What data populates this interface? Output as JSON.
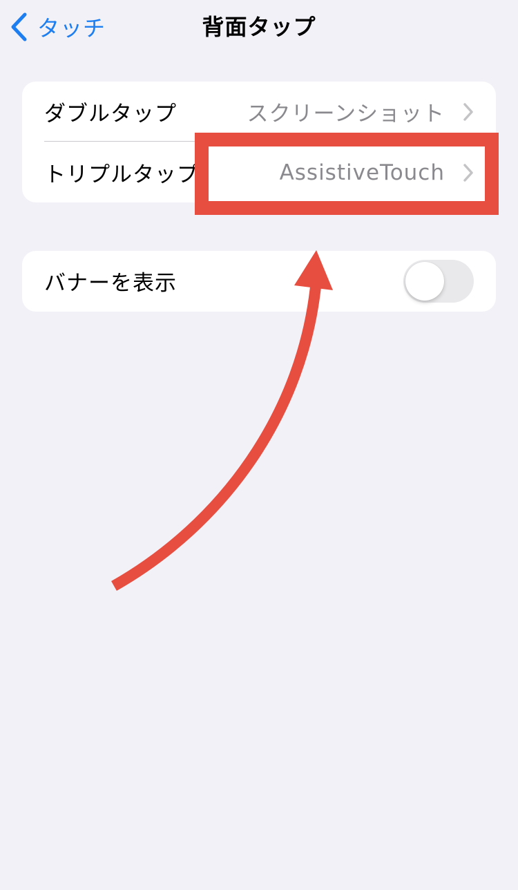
{
  "nav": {
    "back_label": "タッチ",
    "title": "背面タップ"
  },
  "groups": [
    {
      "rows": [
        {
          "label": "ダブルタップ",
          "value": "スクリーンショット"
        },
        {
          "label": "トリプルタップ",
          "value": "AssistiveTouch"
        }
      ]
    },
    {
      "rows": [
        {
          "label": "バナーを表示",
          "toggle_on": false
        }
      ]
    }
  ],
  "colors": {
    "accent": "#1c7ef0",
    "background": "#f2f1f7",
    "annotation": "#e84e40",
    "secondary_text": "#8a8a8e"
  },
  "icons": {
    "back": "chevron-left-icon",
    "disclosure": "chevron-right-icon"
  }
}
